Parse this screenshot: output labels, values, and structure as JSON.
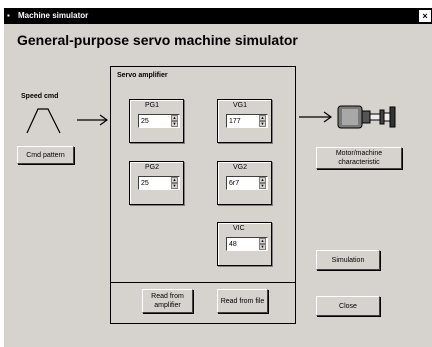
{
  "window": {
    "title": "Machine simulator",
    "close_glyph": "×"
  },
  "heading": "General-purpose servo machine simulator",
  "speed_cmd": {
    "label": "Speed cmd",
    "button": "Cmd pattern"
  },
  "servo_amplifier": {
    "title": "Servo amplifier",
    "params": [
      {
        "label": "PG1",
        "value": "25"
      },
      {
        "label": "VG1",
        "value": "177"
      },
      {
        "label": "PG2",
        "value": "25"
      },
      {
        "label": "VG2",
        "value": "6r7"
      },
      {
        "label": "VIC",
        "value": "48"
      }
    ],
    "read_amplifier": "Read from amplifier",
    "read_file": "Read from file"
  },
  "motor": {
    "button": "Motor/machine characteristic"
  },
  "buttons": {
    "simulation": "Simulation",
    "close": "Close"
  },
  "icons": {
    "window_icon": "app-icon",
    "arrow_in": "arrow-right-icon",
    "arrow_out": "arrow-right-icon",
    "pattern": "trapezoid-pattern-icon",
    "motor": "motor-icon"
  },
  "colors": {
    "window_bg": "#d6d3ce",
    "titlebar": "#000000"
  }
}
